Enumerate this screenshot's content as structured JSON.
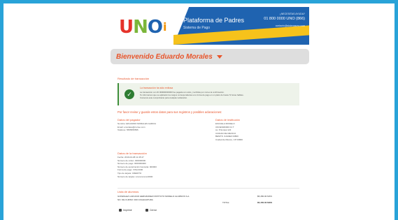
{
  "header": {
    "logo": {
      "u": "U",
      "n": "N",
      "o": "O",
      "i": "i"
    },
    "title": "Plataforma de Padres",
    "subtitle": "Sistema de Pago",
    "contact_label": "¿NECESITAS AYUDA?",
    "phone": "01 800 0000 UNO (866)",
    "email": "contacto@sistemauno.com"
  },
  "welcome": {
    "text": "Bienvenido Eduardo Morales"
  },
  "result": {
    "heading": "Resultado de transacción",
    "title": "La transacción ha sido exitosa",
    "line1": "La transacción con ID 000000000000 fue pagada con éxito y recibirás por correo la confirmación.",
    "line2": "Te informamos que se aplicarán los cargos correspondientes a tu forma de pago en un plazo de hasta 72 horas hábiles.",
    "line3": "Conserva este comprobante para cualquier aclaración."
  },
  "notice": "Por favor revise y guarde estos datos para sus registros y posibles aclaraciones:",
  "payer": {
    "heading": "Datos del pagador",
    "lines": [
      "Nombre: EDUARDO MORALES GARCIA",
      "Email: emorales@correo.com",
      "Teléfono: 5555555555"
    ]
  },
  "school": {
    "heading": "Datos de institución",
    "lines": [
      "ESCUELA MODELO",
      "UNOESM0000 01 T",
      "Av. Principal 123",
      "CIUDAD DE MEXICO",
      "BENITO JUAREZ 03800",
      "Ciudad de México, CP 03800"
    ]
  },
  "transaction": {
    "heading": "Datos de la transacción",
    "lines": [
      "Fecha: 2019-04-08 11:45:47",
      "Número de orden: 000000000",
      "Número de pago: 0000000000",
      "Número de autorización bancaria: 000000",
      "Forma de pago: VISA 0000",
      "Tipo de tarjeta: CREDITO",
      "Número de tarjeta: xxxxxxxxxxxx0000"
    ]
  },
  "items": {
    "heading": "Lista de alumnos",
    "row1": "GONZALEZ LAZCANO HERNANDEZ INSTITUTO MODELO ALUMNOS S.A.",
    "row2": "NO. DE CURSO: 000 COLEGIATURA",
    "amount1": "$5,450.00 MXN",
    "total_label": "TOTAL:",
    "total": "$5,450.00 MXN"
  },
  "actions": {
    "print": "Imprimir",
    "close": "Cerrar"
  },
  "colors": {
    "frame": "#29a3d8",
    "accent": "#e8552b",
    "header_blue": "#1f63b0",
    "success": "#2e7d32"
  }
}
